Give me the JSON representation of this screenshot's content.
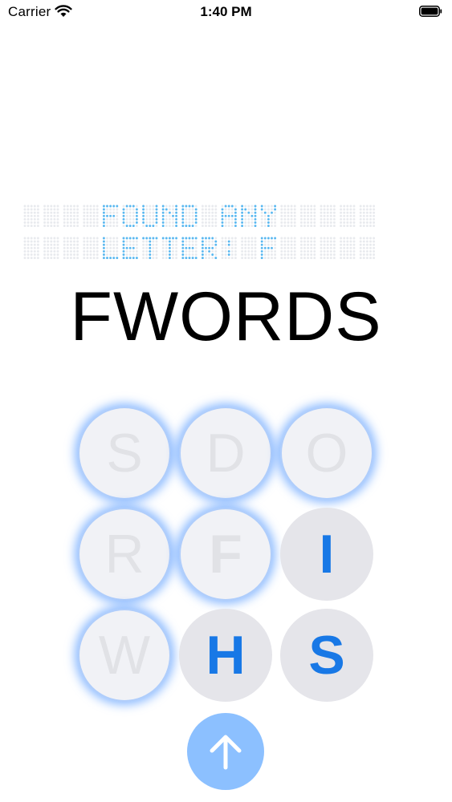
{
  "status_bar": {
    "carrier": "Carrier",
    "time": "1:40 PM"
  },
  "board": {
    "lines": [
      "FOUND ANY",
      "LETTER: F"
    ],
    "dot_color": "#5ab8f0",
    "dim_color": "#e8eaee"
  },
  "title": "FWORDS",
  "tiles": [
    {
      "letter": "S",
      "state": "used"
    },
    {
      "letter": "D",
      "state": "used"
    },
    {
      "letter": "O",
      "state": "used"
    },
    {
      "letter": "R",
      "state": "used"
    },
    {
      "letter": "F",
      "state": "used"
    },
    {
      "letter": "I",
      "state": "free"
    },
    {
      "letter": "W",
      "state": "used"
    },
    {
      "letter": "H",
      "state": "free"
    },
    {
      "letter": "S",
      "state": "free"
    }
  ],
  "submit": {
    "icon": "arrow-up-icon"
  },
  "colors": {
    "accent": "#1878e6",
    "glow": "#5096ff",
    "submit_bg": "#8cc0ff"
  }
}
